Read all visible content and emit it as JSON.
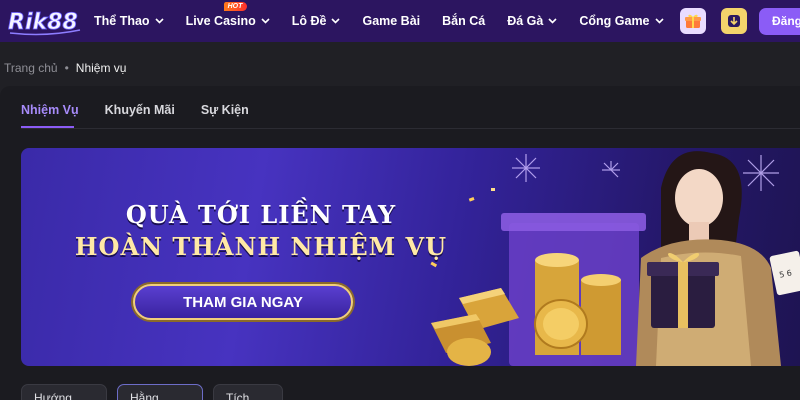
{
  "brand": {
    "logo_text": "Rik88"
  },
  "nav": {
    "items": [
      {
        "label": "Thể Thao",
        "has_dropdown": true
      },
      {
        "label": "Live Casino",
        "has_dropdown": true,
        "badge": "HOT"
      },
      {
        "label": "Lô Đề",
        "has_dropdown": true
      },
      {
        "label": "Game Bài",
        "has_dropdown": false
      },
      {
        "label": "Bắn Cá",
        "has_dropdown": false
      },
      {
        "label": "Đá Gà",
        "has_dropdown": true
      },
      {
        "label": "Cổng Game",
        "has_dropdown": true
      }
    ],
    "gift_icon": "gift-icon",
    "download_icon": "download-icon",
    "login_label": "Đăng"
  },
  "breadcrumb": {
    "home": "Trang chủ",
    "separator": "•",
    "current": "Nhiệm vụ"
  },
  "tabs": [
    {
      "label": "Nhiệm Vụ",
      "active": true
    },
    {
      "label": "Khuyến Mãi",
      "active": false
    },
    {
      "label": "Sự Kiện",
      "active": false
    }
  ],
  "banner": {
    "line1": "QUÀ TỚI LIỀN TAY",
    "line2": "HOÀN THÀNH NHIỆM VỤ",
    "cta": "THAM GIA NGAY"
  },
  "filters": [
    {
      "label": "Hướng dẫn",
      "selected": false
    },
    {
      "label": "Hằng Ngày",
      "selected": true
    },
    {
      "label": "Tích Luỹ",
      "selected": false
    }
  ],
  "colors": {
    "nav_bg": "#2c1560",
    "accent": "#8b5cf6",
    "page_bg": "#202025",
    "banner_gold": "#f1cf7a"
  }
}
